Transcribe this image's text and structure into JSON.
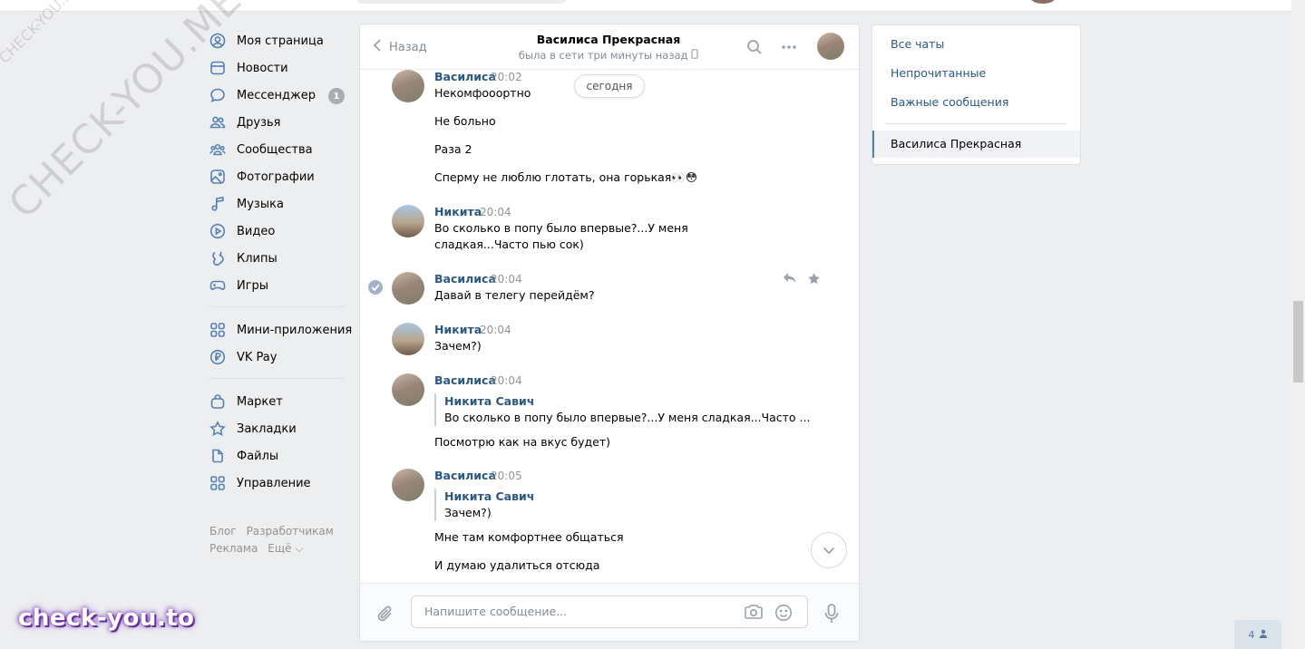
{
  "watermarks": {
    "small": "CHECK-YOU.ME",
    "large": "CHECK-YOU.ME"
  },
  "sidebar": {
    "items": [
      {
        "label": "Моя страница",
        "icon": "user-circle-icon"
      },
      {
        "label": "Новости",
        "icon": "news-icon"
      },
      {
        "label": "Мессенджер",
        "icon": "message-bubble-icon",
        "badge": "1"
      },
      {
        "label": "Друзья",
        "icon": "friends-icon"
      },
      {
        "label": "Сообщества",
        "icon": "communities-icon"
      },
      {
        "label": "Фотографии",
        "icon": "photo-icon"
      },
      {
        "label": "Музыка",
        "icon": "music-note-icon"
      },
      {
        "label": "Видео",
        "icon": "video-play-icon"
      },
      {
        "label": "Клипы",
        "icon": "clips-icon"
      },
      {
        "label": "Игры",
        "icon": "gamepad-icon"
      }
    ],
    "items2": [
      {
        "label": "Мини-приложения",
        "icon": "apps-grid-icon"
      },
      {
        "label": "VK Pay",
        "icon": "ruble-icon"
      }
    ],
    "items3": [
      {
        "label": "Маркет",
        "icon": "shopping-bag-icon"
      },
      {
        "label": "Закладки",
        "icon": "star-icon"
      },
      {
        "label": "Файлы",
        "icon": "file-icon"
      },
      {
        "label": "Управление",
        "icon": "apps-grid-icon"
      }
    ],
    "footer": {
      "blog": "Блог",
      "developers": "Разработчикам",
      "ads": "Реклама",
      "more": "Ещё ⌵"
    }
  },
  "chat": {
    "back_label": "Назад",
    "title": "Василиса Прекрасная",
    "status": "была в сети три минуты назад",
    "date_pill": "сегодня",
    "messages": [
      {
        "author": "Василиса",
        "time": "20:02",
        "lines": [
          "Некомфооортно",
          "Не больно",
          "Раза 2",
          "Сперму не люблю глотать, она горькая👀😳"
        ]
      },
      {
        "author": "Никита",
        "time": "20:04",
        "lines": [
          "Во сколько в попу было впервые?...У меня сладкая...Часто пью сок)"
        ]
      },
      {
        "author": "Василиса",
        "time": "20:04",
        "lines": [
          "Давай в телегу перейдём?"
        ]
      },
      {
        "author": "Никита",
        "time": "20:04",
        "lines": [
          "Зачем?)"
        ]
      },
      {
        "author": "Василиса",
        "time": "20:04",
        "quote_author": "Никита Савич",
        "quote_text": "Во сколько в попу было впервые?...У меня сладкая...Часто ...",
        "lines": [
          "Посмотрю как на вкус будет)"
        ]
      },
      {
        "author": "Василиса",
        "time": "20:05",
        "quote_author": "Никита Савич",
        "quote_text": "Зачем?)",
        "lines": [
          "Мне там комфортнее общаться",
          "И думаю удалиться отсюда"
        ]
      }
    ],
    "composer_placeholder": "Напишите сообщение..."
  },
  "right_panel": {
    "all_chats": "Все чаты",
    "unread": "Непрочитанные",
    "important": "Важные сообщения",
    "active_chat": "Василиса Прекрасная"
  },
  "online_count": "4",
  "brand": "check-you.to",
  "colors": {
    "link": "#2a5885",
    "accent": "#5181b8",
    "background": "#edeef0",
    "brand_glow": "#7a3bb8"
  }
}
